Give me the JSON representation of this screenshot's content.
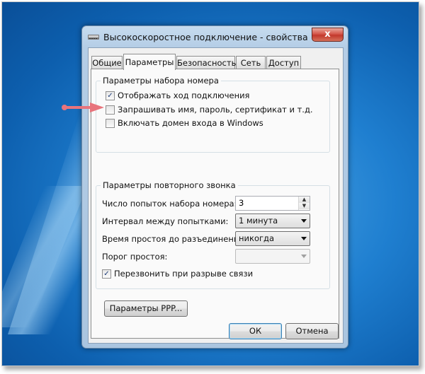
{
  "window": {
    "title": "Высокоскоростное подключение - свойства",
    "close_glyph": "x"
  },
  "tabs": [
    {
      "label": "Общие",
      "active": false
    },
    {
      "label": "Параметры",
      "active": true
    },
    {
      "label": "Безопасность",
      "active": false
    },
    {
      "label": "Сеть",
      "active": false
    },
    {
      "label": "Доступ",
      "active": false
    }
  ],
  "dialing": {
    "title": "Параметры набора номера",
    "options": [
      {
        "label": "Отображать ход подключения",
        "checked": true
      },
      {
        "label": "Запрашивать имя, пароль, сертификат и т.д.",
        "checked": false
      },
      {
        "label": "Включать домен входа в Windows",
        "checked": false
      }
    ]
  },
  "redial": {
    "title": "Параметры повторного звонка",
    "attempts_label": "Число попыток набора номера:",
    "attempts_value": "3",
    "interval_label": "Интервал между попытками:",
    "interval_value": "1 минута",
    "idle_label": "Время простоя до разъединения:",
    "idle_value": "никогда",
    "threshold_label": "Порог простоя:",
    "threshold_value": "",
    "redial_on_drop_label": "Перезвонить при разрыве связи",
    "redial_on_drop_checked": true
  },
  "buttons": {
    "ppp": "Параметры PPP...",
    "ok": "ОК",
    "cancel": "Отмена"
  },
  "icons": {
    "title": "network-connection-icon",
    "pointer": "red-arrow-icon"
  },
  "colors": {
    "desktop": "#1f7fd0",
    "arrow": "#e8747c",
    "check": "#1b3a78"
  }
}
